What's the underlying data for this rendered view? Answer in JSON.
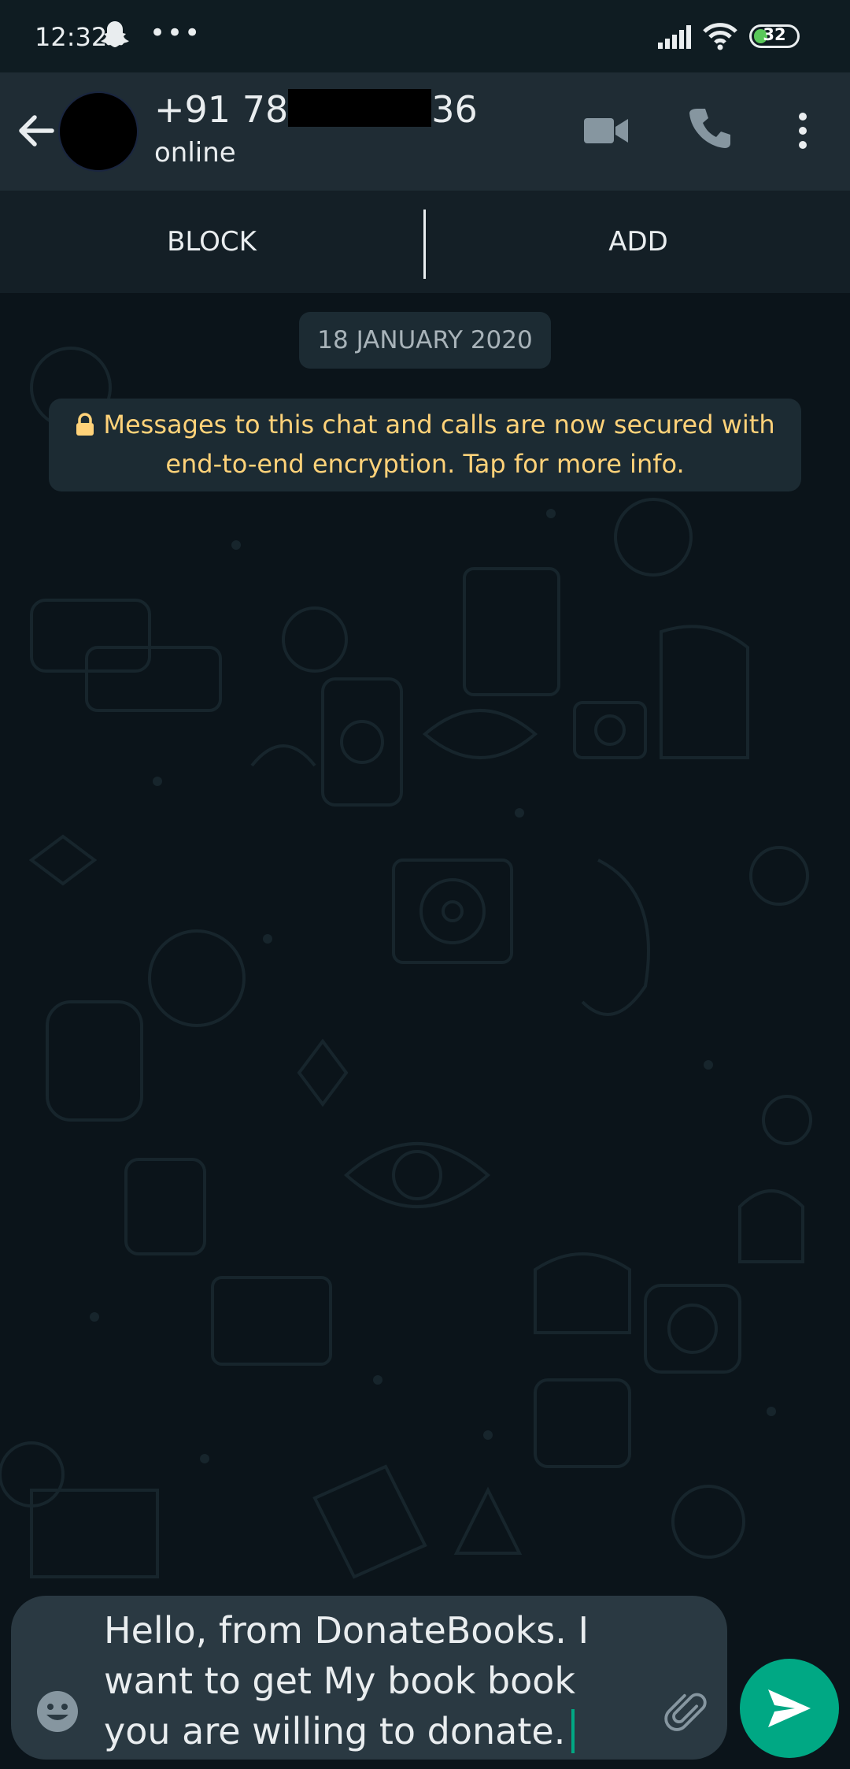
{
  "status_bar": {
    "time": "12:32",
    "more_dots": "•••",
    "battery_level": "32",
    "icons": [
      "snapchat-icon",
      "signal-icon",
      "wifi-icon",
      "battery-icon"
    ]
  },
  "header": {
    "contact_prefix": "+91 78",
    "contact_suffix": "36",
    "status": "online",
    "icons": [
      "back-arrow-icon",
      "video-call-icon",
      "phone-icon",
      "more-vert-icon"
    ]
  },
  "actions": {
    "block_label": "BLOCK",
    "add_label": "ADD"
  },
  "chat": {
    "date_chip": "18 JANUARY 2020",
    "encryption_notice": "Messages to this chat and calls are now secured with end-to-end encryption. Tap for more info."
  },
  "composer": {
    "message_text": "Hello, from DonateBooks. I\nwant to get My book book\nyou are willing to donate.",
    "icons": [
      "emoji-icon",
      "attach-icon",
      "send-icon"
    ]
  },
  "colors": {
    "accent": "#00a884",
    "header_bg": "#1f2c34",
    "chat_bg": "#0b141a",
    "notice_text": "#ffd279"
  }
}
